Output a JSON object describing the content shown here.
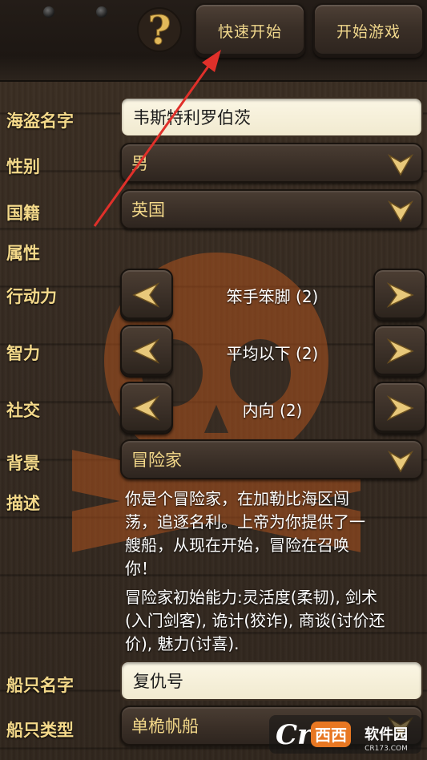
{
  "toolbar": {
    "help_icon": "question-mark-icon",
    "quick_start_label": "快速开始",
    "start_game_label": "开始游戏"
  },
  "form": {
    "pirate_name": {
      "label": "海盗名字",
      "value": "韦斯特利罗伯茨"
    },
    "gender": {
      "label": "性别",
      "value": "男"
    },
    "nationality": {
      "label": "国籍",
      "value": "英国"
    },
    "attributes_heading": "属性",
    "attributes": [
      {
        "label": "行动力",
        "value": "笨手笨脚 (2)"
      },
      {
        "label": "智力",
        "value": "平均以下 (2)"
      },
      {
        "label": "社交",
        "value": "内向 (2)"
      }
    ],
    "background": {
      "label": "背景",
      "value": "冒险家"
    },
    "description": {
      "label": "描述",
      "lines_main": [
        "你是个冒险家，在加勒比海区闯",
        "荡，追逐名利。上帝为你提供了一",
        "艘船，从现在开始，冒险在召唤",
        "你！"
      ],
      "lines_abilities": [
        "冒险家初始能力:灵活度(柔韧), 剑术",
        "(入门剑客), 诡计(狡诈), 商谈(讨价还",
        "价), 魅力(讨喜)."
      ]
    },
    "ship_name": {
      "label": "船只名字",
      "value": "复仇号"
    },
    "ship_type": {
      "label": "船只类型",
      "value": "单桅帆船"
    }
  },
  "watermark": {
    "brand": "西西",
    "text": "软件园",
    "url": "CR173.COM"
  },
  "colors": {
    "label_gold": "#f4d98a",
    "annotation_red": "#e0302a"
  }
}
